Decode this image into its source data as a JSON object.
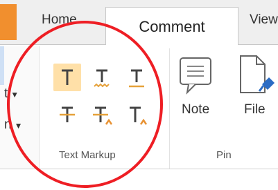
{
  "tabs": {
    "home": "Home",
    "comment": "Comment",
    "view": "View"
  },
  "left_fragments": [
    {
      "text": "t"
    },
    {
      "text": "n"
    }
  ],
  "text_markup": {
    "label": "Text Markup",
    "tools": [
      {
        "name": "highlight-text",
        "active": true
      },
      {
        "name": "squiggly-underline"
      },
      {
        "name": "underline"
      },
      {
        "name": "strikeout"
      },
      {
        "name": "replace-text"
      },
      {
        "name": "insert-text"
      }
    ]
  },
  "pin": {
    "label": "Pin",
    "note_label": "Note",
    "file_label": "File"
  },
  "colors": {
    "accent": "#f18f2e",
    "highlight": "#ffe0a8",
    "squiggle": "#e6a13a",
    "caret": "#e89233",
    "pin_blue": "#2b6cc4",
    "annotation_circle": "#ee1e24"
  }
}
